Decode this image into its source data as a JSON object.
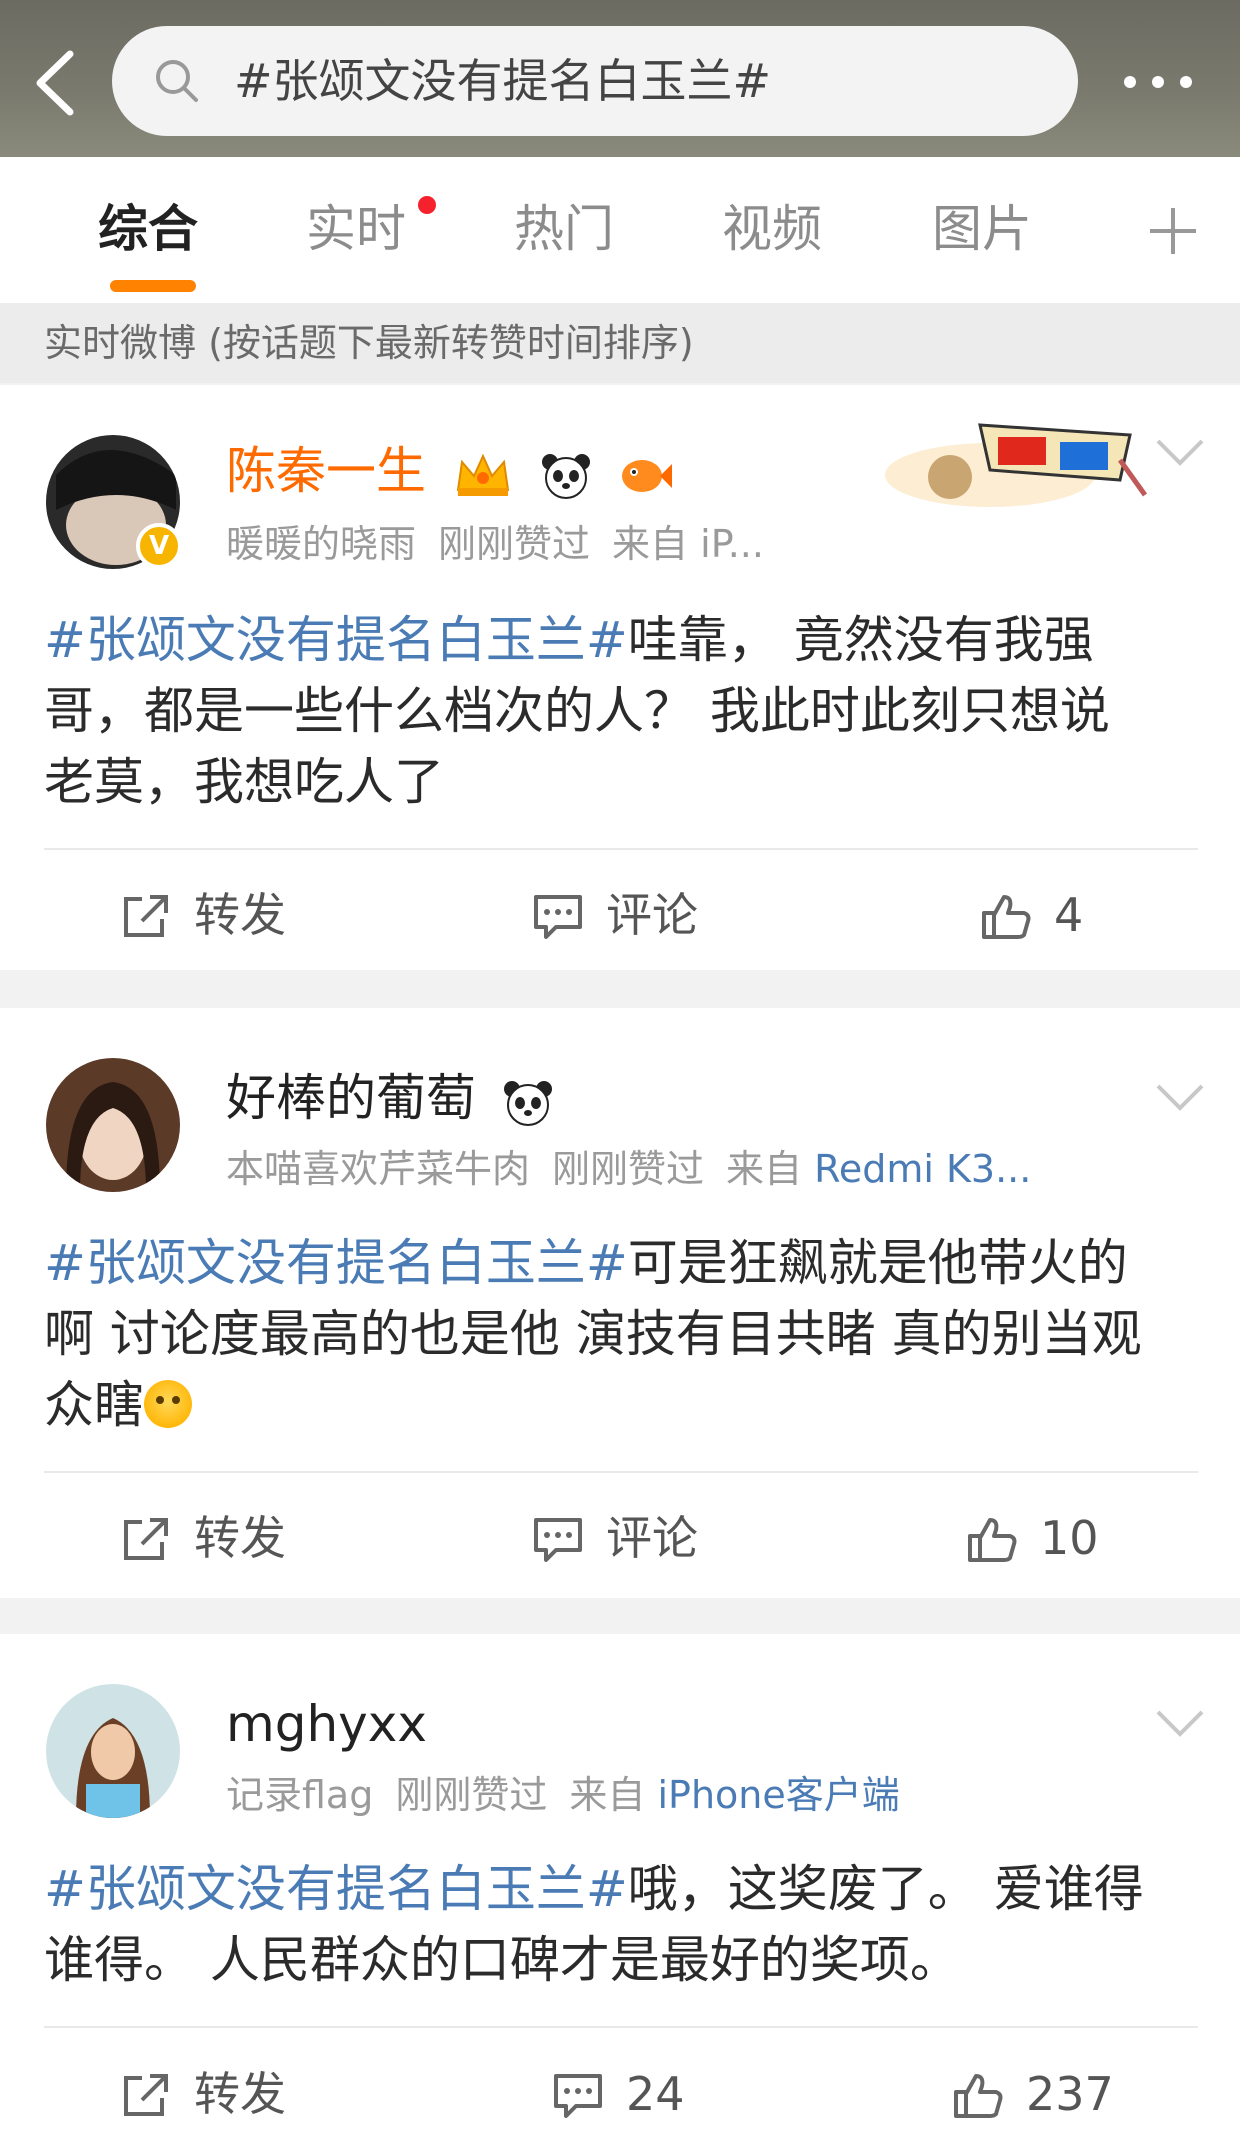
{
  "search": {
    "query": "#张颂文没有提名白玉兰#"
  },
  "tabs": [
    {
      "label": "综合",
      "active": true
    },
    {
      "label": "实时",
      "has_dot": true
    },
    {
      "label": "热门"
    },
    {
      "label": "视频"
    },
    {
      "label": "图片"
    }
  ],
  "subheader": "实时微博 (按话题下最新转赞时间排序)",
  "colors": {
    "accent": "#ff8200",
    "link": "#4a7bb5",
    "vip_name": "#ff6a00",
    "notify_dot": "#f5222d"
  },
  "posts": [
    {
      "username": "陈秦一生",
      "verified": true,
      "liked_by": "暖暖的晓雨",
      "action": "刚刚赞过",
      "source_prefix": "来自",
      "source": "iP...",
      "topic": "#张颂文没有提名白玉兰#",
      "body_line1": "哇靠， 竟然没有我强",
      "body_line2": "哥，都是一些什么档次的人？ 我此时此刻只想说",
      "body_line3": "老莫，我想吃人了",
      "repost_label": "转发",
      "comment_label": "评论",
      "likes": "4",
      "icons": [
        "crown-badge-icon",
        "panda-icon",
        "fish-icon",
        "3d-glasses-sticker"
      ]
    },
    {
      "username": "好棒的葡萄",
      "liked_by": "本喵喜欢芹菜牛肉",
      "action": "刚刚赞过",
      "source_prefix": "来自",
      "source": "Redmi K3...",
      "topic": "#张颂文没有提名白玉兰#",
      "body_line1": "可是狂飙就是他带火的",
      "body_line2": "啊 讨论度最高的也是他 演技有目共睹 真的别当观",
      "body_line3": "众瞎",
      "repost_label": "转发",
      "comment_label": "评论",
      "likes": "10",
      "icons": [
        "panda-icon",
        "emoji-face-icon"
      ]
    },
    {
      "username": "mghyxx",
      "liked_by": "记录flag",
      "action": "刚刚赞过",
      "source_prefix": "来自",
      "source": "iPhone客户端",
      "topic": "#张颂文没有提名白玉兰#",
      "body_line1": "哦，这奖废了。 爱谁得",
      "body_line2": "谁得。 人民群众的口碑才是最好的奖项。",
      "repost_label": "转发",
      "comments": "24",
      "likes": "237"
    }
  ]
}
